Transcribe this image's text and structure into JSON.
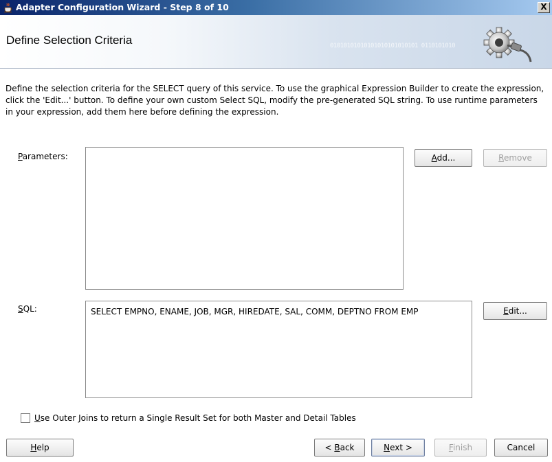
{
  "window": {
    "title": "Adapter Configuration Wizard - Step 8 of 10",
    "close_glyph": "X"
  },
  "header": {
    "title": "Define Selection Criteria",
    "decoration_text": "01010101010101010101010101 0110101010",
    "icon": "gear-plug-icon"
  },
  "description": "Define the selection criteria for the SELECT query of this service.  To use the graphical Expression Builder to create the expression, click the 'Edit...' button.  To define your own custom Select SQL, modify the pre-generated SQL string.  To use runtime parameters in your expression, add them here before defining the expression.",
  "parameters": {
    "label_mnemonic": "P",
    "label_rest": "arameters:",
    "items": [],
    "add_button": {
      "mnemonic": "A",
      "rest": "dd..."
    },
    "remove_button": {
      "mnemonic": "R",
      "rest": "emove",
      "enabled": false
    }
  },
  "sql": {
    "label_mnemonic": "S",
    "label_rest": "QL:",
    "value": "SELECT EMPNO, ENAME, JOB, MGR, HIREDATE, SAL, COMM, DEPTNO FROM EMP",
    "edit_button": {
      "mnemonic": "E",
      "rest": "dit..."
    }
  },
  "outer_join": {
    "checked": false,
    "label_mnemonic": "U",
    "label_rest": "se Outer Joins to return a Single Result Set for both Master and Detail Tables"
  },
  "footer": {
    "help": {
      "mnemonic": "H",
      "rest": "elp"
    },
    "back": {
      "prefix": "< ",
      "mnemonic": "B",
      "rest": "ack"
    },
    "next": {
      "mnemonic": "N",
      "rest": "ext >"
    },
    "finish": {
      "mnemonic": "F",
      "rest": "inish",
      "enabled": false
    },
    "cancel": {
      "label": "Cancel"
    }
  },
  "colors": {
    "titlebar_start": "#0a246a",
    "titlebar_end": "#a6caf0",
    "disabled_text": "#a0a0a0"
  }
}
